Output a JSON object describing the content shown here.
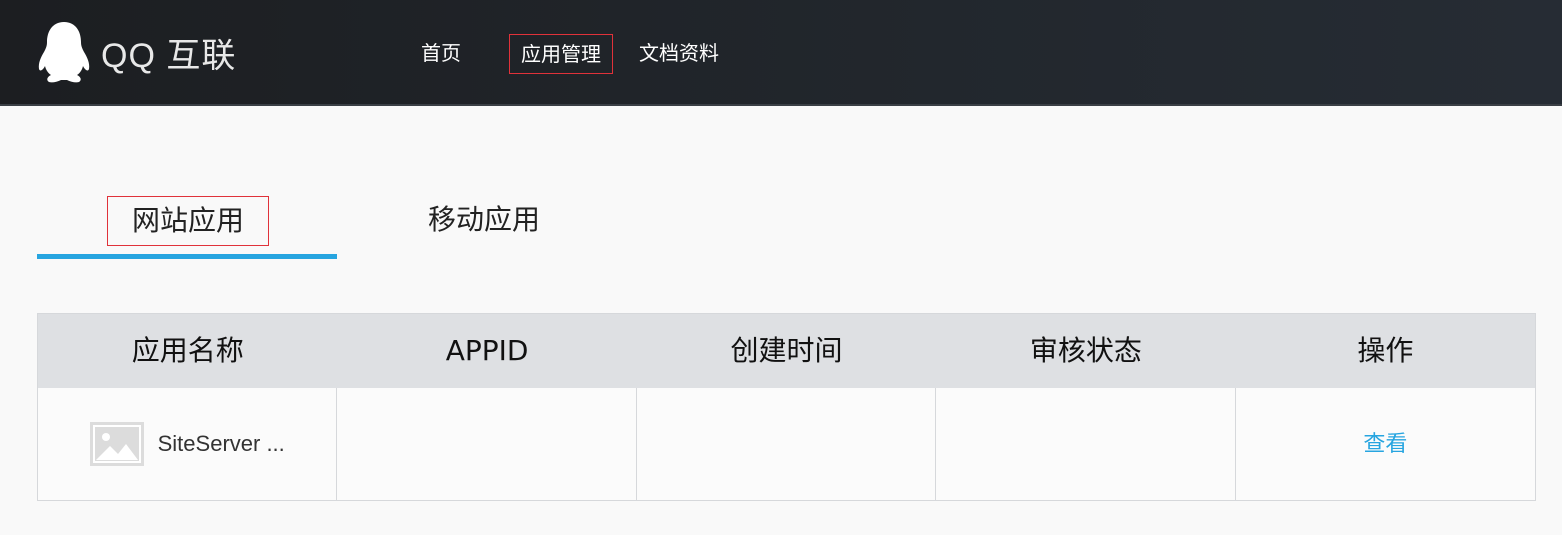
{
  "header": {
    "logo_text": "QQ 互联",
    "nav": [
      "首页",
      "应用管理",
      "文档资料"
    ]
  },
  "tabs": [
    "网站应用",
    "移动应用"
  ],
  "table": {
    "columns": [
      "应用名称",
      "APPID",
      "创建时间",
      "审核状态",
      "操作"
    ],
    "rows": [
      {
        "name": "SiteServer ...",
        "appid": "",
        "created": "",
        "status": "",
        "action": "查看"
      }
    ]
  },
  "colors": {
    "accent": "#27a5e0",
    "highlight_border": "#e0323a",
    "header_bg": "#22272d"
  },
  "icons": [
    "qq-penguin-icon",
    "image-placeholder-icon"
  ]
}
